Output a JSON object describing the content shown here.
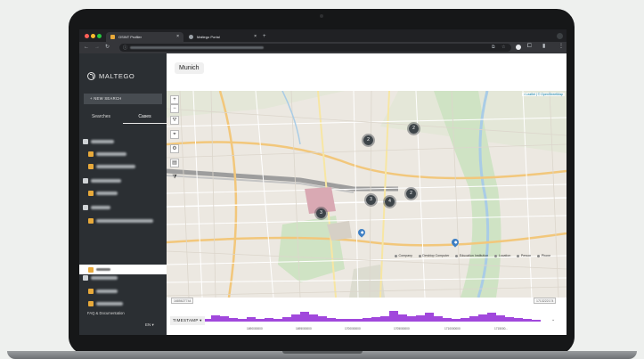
{
  "browser": {
    "tabs": [
      {
        "title": "OSINT Profiler",
        "active": true,
        "favicon_color": "#e8a93a"
      },
      {
        "title": "Maltego Portal",
        "active": false,
        "favicon_color": "#9aa0a6"
      }
    ],
    "new_tab": "+",
    "close_glyph": "×"
  },
  "sidebar": {
    "logo_text": "MALTEGO",
    "new_search_label": "+ NEW SEARCH",
    "tabs": [
      {
        "label": "Searches",
        "active": false
      },
      {
        "label": "Cases",
        "active": true
      }
    ],
    "footer_link": "FAQ & Documentation",
    "language": "EN ▾"
  },
  "main": {
    "case_title": "Munich",
    "map_attribution": "▪ Leaflet | © OpenStreetMap",
    "tools": [
      "+",
      "−",
      "⛛",
      "⌖",
      "⚙",
      "▤",
      "⧩"
    ],
    "clusters": [
      "2",
      "2",
      "3",
      "4",
      "2",
      "3"
    ],
    "legend": [
      "Company",
      "Desktop Computer",
      "Education Institution",
      "Location",
      "Person",
      "Phone"
    ]
  },
  "timeline": {
    "start": "1685627744",
    "end": "1713222174",
    "timestamp_label": "TIMESTAMP ▾",
    "ticks": [
      "1690000000",
      "1695000000",
      "1700000000",
      "1705000000",
      "1710000000",
      "1715000..."
    ],
    "histogram": [
      0.1,
      0.28,
      0.22,
      0.15,
      0.12,
      0.18,
      0.12,
      0.15,
      0.1,
      0.18,
      0.3,
      0.42,
      0.32,
      0.22,
      0.15,
      0.12,
      0.1,
      0.12,
      0.15,
      0.18,
      0.25,
      0.45,
      0.32,
      0.22,
      0.28,
      0.38,
      0.22,
      0.16,
      0.12,
      0.16,
      0.22,
      0.3,
      0.38,
      0.28,
      0.2,
      0.16,
      0.12,
      0.08
    ],
    "toggle": "⌄"
  },
  "colors": {
    "accent": "#a148dc",
    "sidebar": "#2b2f33",
    "pin": "#3e7fc4",
    "cluster": "#3d4449"
  }
}
